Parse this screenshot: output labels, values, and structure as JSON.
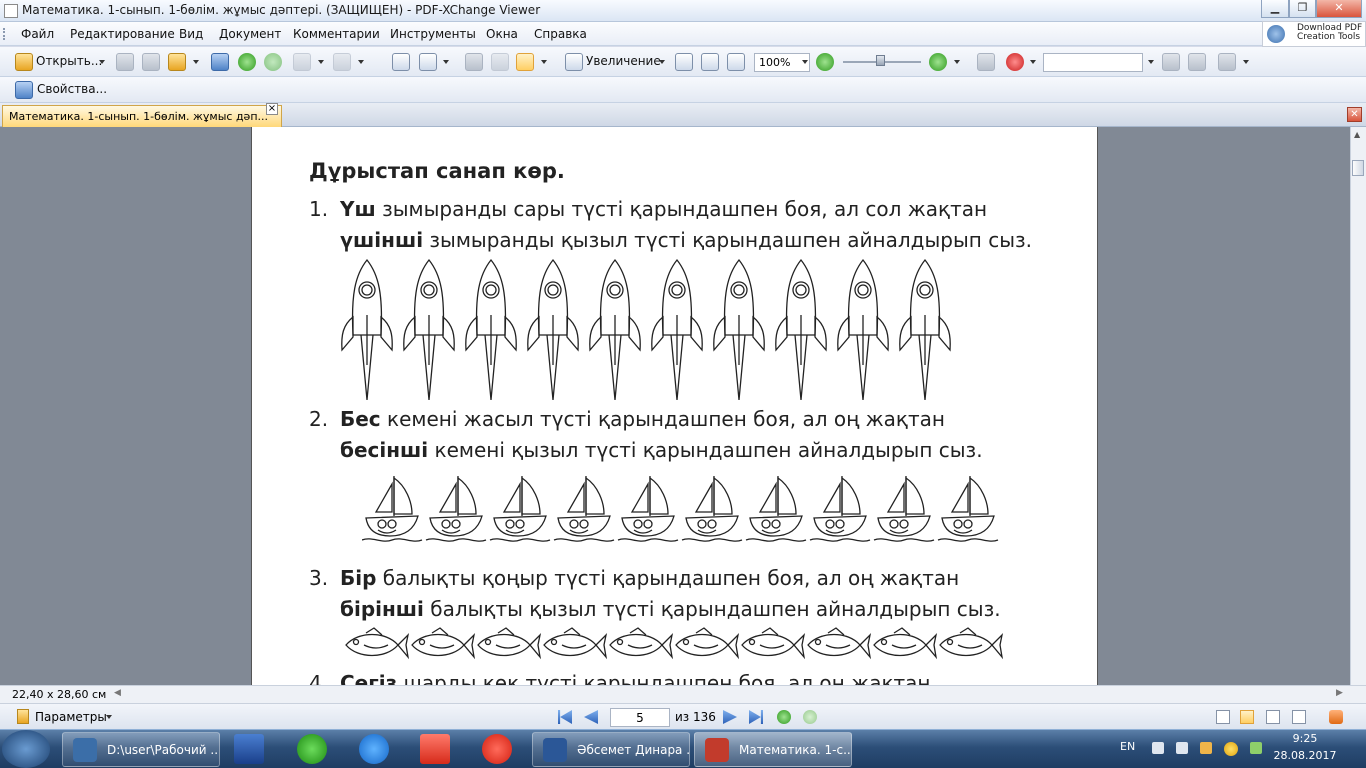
{
  "window": {
    "title": "Математика. 1-сынып. 1-бөлім. жұмыс дәптері. (ЗАЩИЩЕН) - PDF-XChange Viewer"
  },
  "menu": [
    "Файл",
    "Редактирование",
    "Вид",
    "Документ",
    "Комментарии",
    "Инструменты",
    "Окна",
    "Справка"
  ],
  "promo": {
    "line1": "Download PDF",
    "line2": "Creation Tools"
  },
  "toolbar": {
    "open_label": "Открыть...",
    "zoom_label": "Увеличение",
    "zoom_value": "100%",
    "properties_label": "Свойства..."
  },
  "tab": {
    "label": "Математика. 1-сынып. 1-бөлім. жұмыс дәп...",
    "close": "×"
  },
  "page": {
    "heading": "Дұрыстап санап көр.",
    "tasks": [
      {
        "num": "1.",
        "line1_bold": "Үш",
        "line1_rest": " зымыранды сары түсті қарындашпен боя, ал сол жақтан",
        "line2_bold": "үшінші",
        "line2_rest": " зымыранды қызыл түсті қарындашпен айналдырып сыз."
      },
      {
        "num": "2.",
        "line1_bold": "Бес",
        "line1_rest": " кемені жасыл түсті қарындашпен боя, ал оң жақтан",
        "line2_bold": "бесінші",
        "line2_rest": " кемені қызыл түсті қарындашпен айналдырып сыз."
      },
      {
        "num": "3.",
        "line1_bold": "Бір",
        "line1_rest": " балықты қоңыр түсті қарындашпен боя, ал оң жақтан",
        "line2_bold": "бірінші",
        "line2_rest": " балықты қызыл түсті қарындашпен айналдырып сыз."
      },
      {
        "num": "4.",
        "line1_bold": "Сегіз",
        "line1_rest": " шарды көк түсті қарындашпен боя, ал оң жақтан"
      }
    ],
    "rocket_count": 10,
    "boat_count": 10,
    "fish_count": 10
  },
  "status": {
    "page_size": "22,40 x 28,60 см",
    "options_label": "Параметры",
    "current_page": "5",
    "total_pages": "из 136"
  },
  "taskbar": {
    "items": [
      {
        "label": "D:\\user\\Рабочий ...",
        "color": "#3b6ea8"
      },
      {
        "label": "Әбсемет Динара ...",
        "color": "#2b5797"
      },
      {
        "label": "Математика. 1-с...",
        "color": "#c23b2c"
      }
    ],
    "lang": "EN",
    "time": "9:25",
    "date": "28.08.2017"
  },
  "colors": {
    "tab_active": "#ffd87a",
    "doc_bg": "#818995",
    "taskbar": "#2c4e78"
  }
}
